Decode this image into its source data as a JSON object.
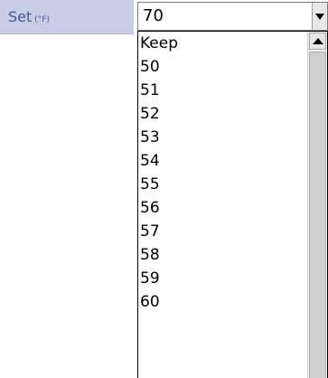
{
  "setting": {
    "label": "Set",
    "unit": "(°F)"
  },
  "select": {
    "selected_value": "70",
    "options": [
      "Keep",
      "50",
      "51",
      "52",
      "53",
      "54",
      "55",
      "56",
      "57",
      "58",
      "59",
      "60"
    ]
  },
  "icons": {
    "dropdown_arrow": "chevron-down-icon",
    "scroll_up": "scroll-up-arrow-icon"
  },
  "colors": {
    "label_background": "#c6cde6",
    "label_text": "#4a5a8a"
  }
}
